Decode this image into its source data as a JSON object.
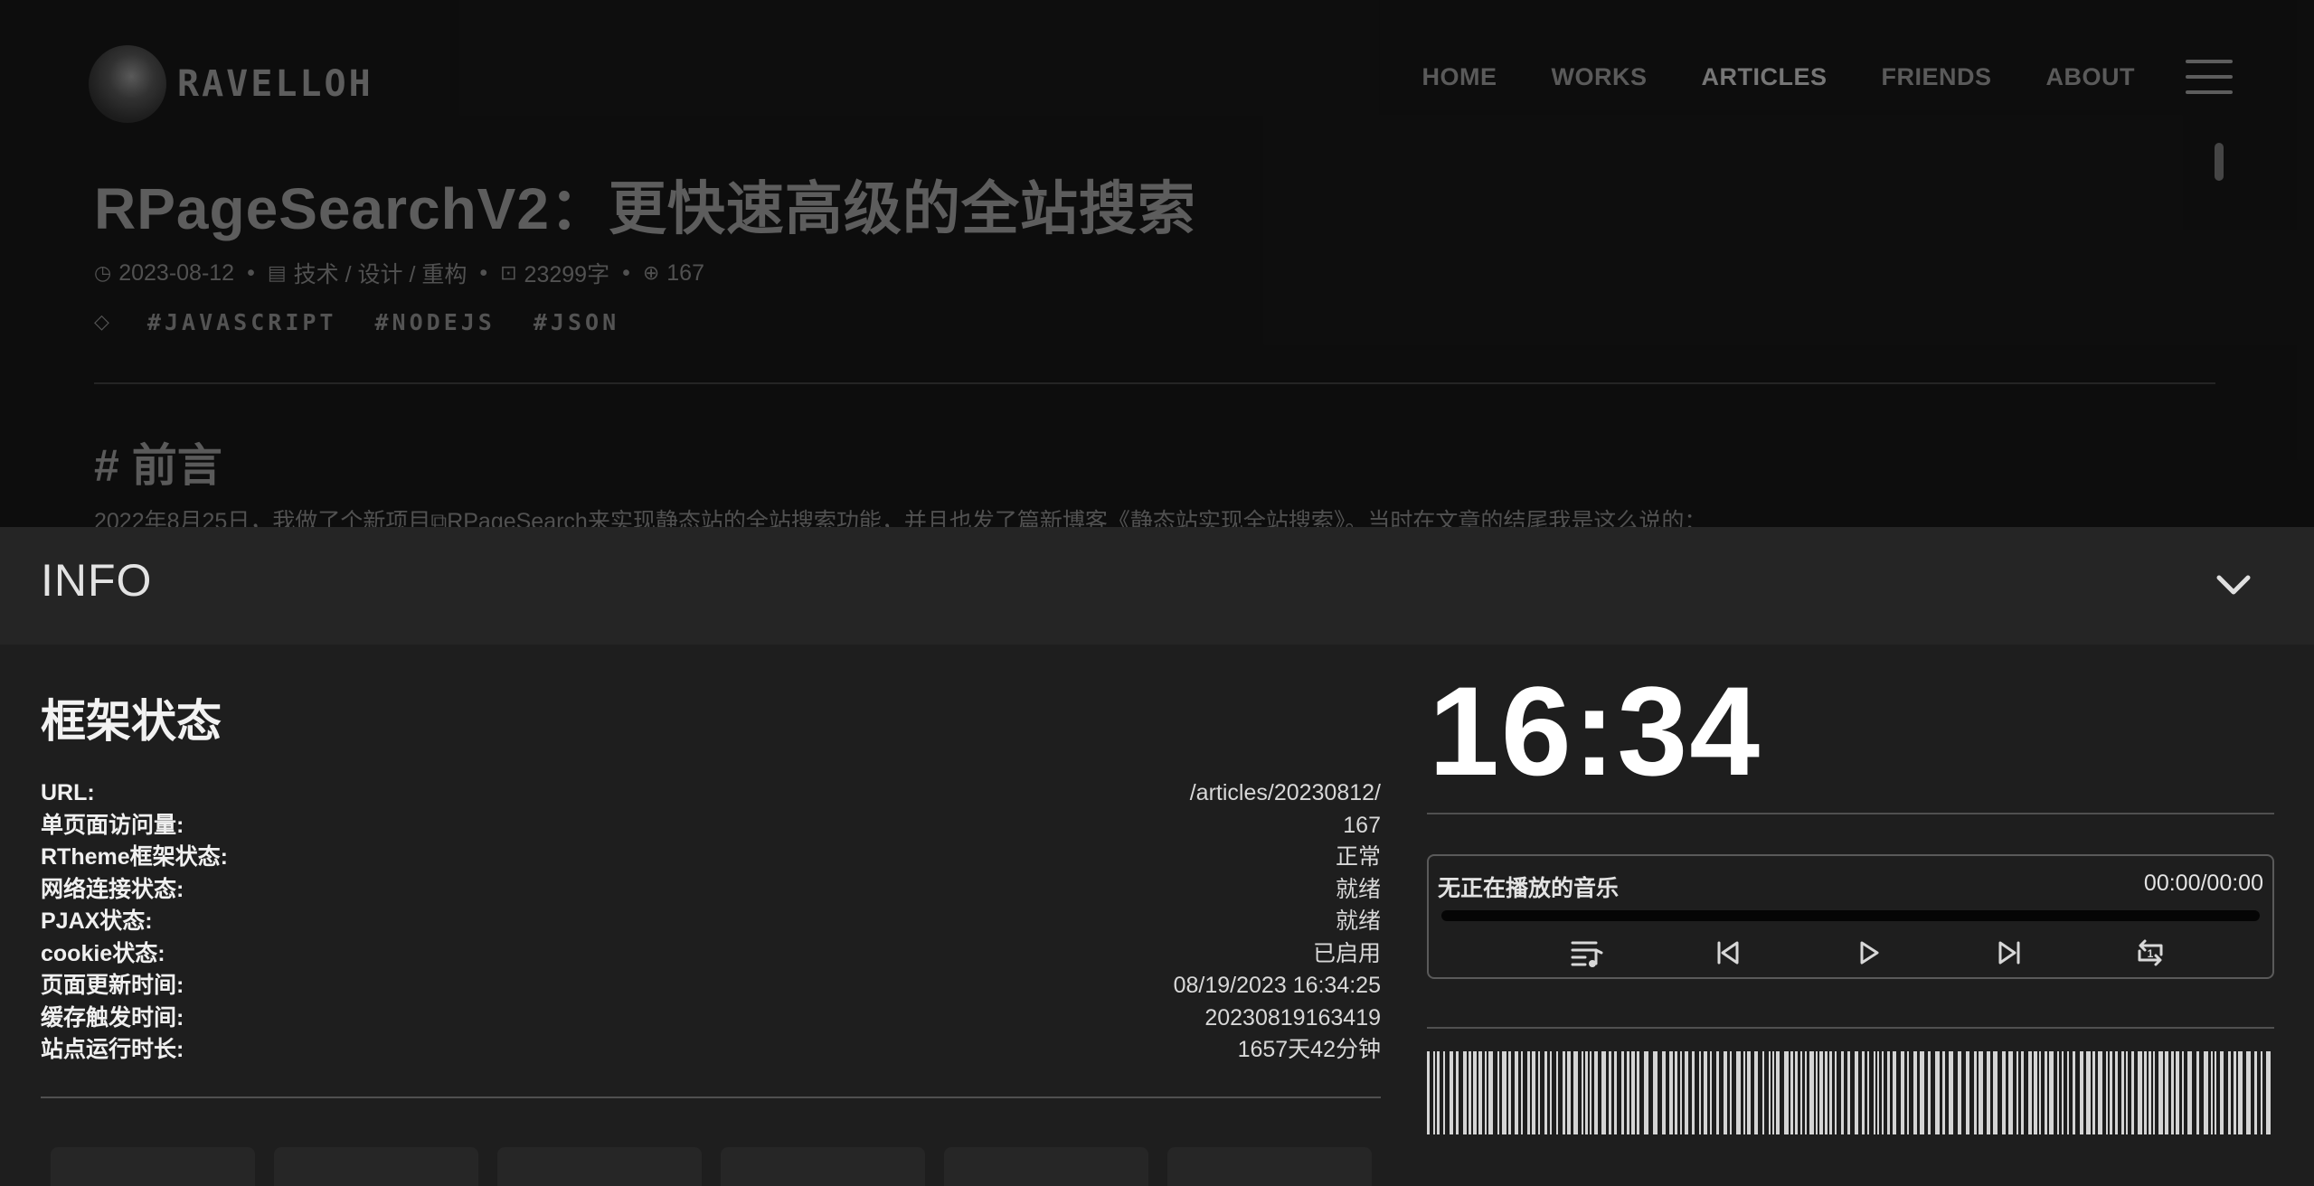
{
  "site": {
    "logo_text": "RAVELLOH",
    "nav": [
      "HOME",
      "WORKS",
      "ARTICLES",
      "FRIENDS",
      "ABOUT"
    ],
    "active_nav": "ARTICLES"
  },
  "article": {
    "title": "RPageSearchV2：更快速高级的全站搜索",
    "date": "2023-08-12",
    "categories": "技术 / 设计 / 重构",
    "word_count": "23299字",
    "views": "167",
    "tags": [
      "#JAVASCRIPT",
      "#NODEJS",
      "#JSON"
    ],
    "section_heading": "# 前言",
    "para_before": "2022年8月25日，我做了个新项目",
    "para_link": "RPageSearch",
    "para_after": "来实现静态站的全站搜索功能，并且也发了篇新博客《静态站实现全站搜索》。当时在文章的结尾我是这么说的："
  },
  "info": {
    "title": "INFO",
    "status_title": "框架状态",
    "rows": [
      {
        "label": "URL:",
        "value": "/articles/20230812/"
      },
      {
        "label": "单页面访问量:",
        "value": "167"
      },
      {
        "label": "RTheme框架状态:",
        "value": "正常"
      },
      {
        "label": "网络连接状态:",
        "value": "就绪"
      },
      {
        "label": "PJAX状态:",
        "value": "就绪"
      },
      {
        "label": "cookie状态:",
        "value": "已启用"
      },
      {
        "label": "页面更新时间:",
        "value": "08/19/2023 16:34:25"
      },
      {
        "label": "缓存触发时间:",
        "value": "20230819163419"
      },
      {
        "label": "站点运行时长:",
        "value": "1657天42分钟"
      }
    ],
    "clock": "16:34",
    "player": {
      "track": "无正在播放的音乐",
      "time": "00:00/00:00",
      "progress": 0
    }
  },
  "icons": {
    "menu": "hamburger-icon",
    "collapse": "chevron-down-icon",
    "playlist": "playlist-icon",
    "prev": "skip-previous-icon",
    "play": "play-icon",
    "next": "skip-next-icon",
    "repeat": "repeat-one-icon"
  },
  "colors": {
    "panel_bg": "#1e1e1e",
    "header_bg": "#252525",
    "text": "#ffffff"
  }
}
